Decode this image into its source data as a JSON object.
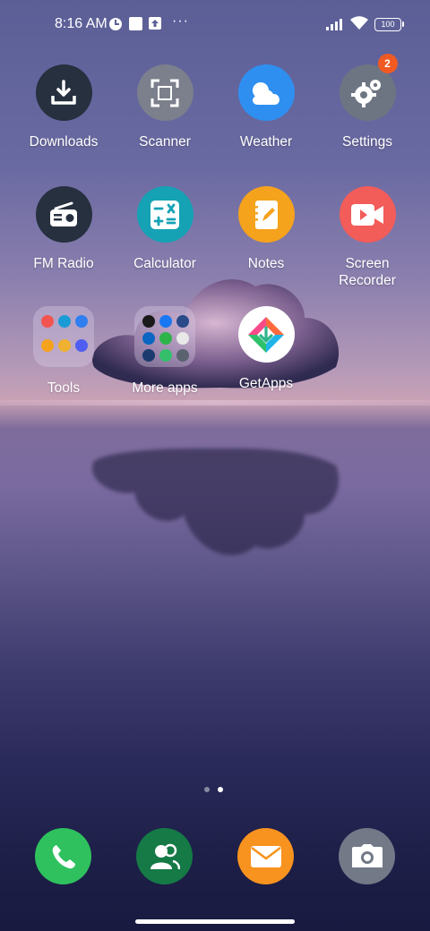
{
  "status_bar": {
    "time": "8:16 AM",
    "more": "···",
    "battery": "100",
    "icons": [
      "clock-settings-icon",
      "square-notification-icon",
      "upload-notification-icon",
      "signal-icon",
      "wifi-icon",
      "battery-icon"
    ]
  },
  "apps": [
    {
      "label": "Downloads",
      "icon": "download-icon",
      "color": "#26303f"
    },
    {
      "label": "Scanner",
      "icon": "scan-icon",
      "color": "#7b808c"
    },
    {
      "label": "Weather",
      "icon": "cloud-icon",
      "color": "#2f8ff0"
    },
    {
      "label": "Settings",
      "icon": "gear-icon",
      "color": "#6e7582",
      "badge": "2"
    },
    {
      "label": "FM Radio",
      "icon": "radio-icon",
      "color": "#26303f"
    },
    {
      "label": "Calculator",
      "icon": "calculator-icon",
      "color": "#15a2b5"
    },
    {
      "label": "Notes",
      "icon": "notes-icon",
      "color": "#f5a21c"
    },
    {
      "label": "Screen Recorder",
      "icon": "video-camera-icon",
      "color": "#f25c59"
    },
    {
      "label": "Tools",
      "icon": "folder-icon"
    },
    {
      "label": "More apps",
      "icon": "folder-icon"
    },
    {
      "label": "GetApps",
      "icon": "getapps-icon",
      "color": "#ffffff"
    }
  ],
  "dock": [
    {
      "name": "phone",
      "icon": "phone-icon",
      "color": "#2fc15e"
    },
    {
      "name": "contacts",
      "icon": "contacts-icon",
      "color": "#157a46"
    },
    {
      "name": "messages",
      "icon": "envelope-icon",
      "color": "#f7931e"
    },
    {
      "name": "camera",
      "icon": "camera-icon",
      "color": "#737987"
    }
  ],
  "page_indicator": {
    "pages": 2,
    "current": 2
  }
}
